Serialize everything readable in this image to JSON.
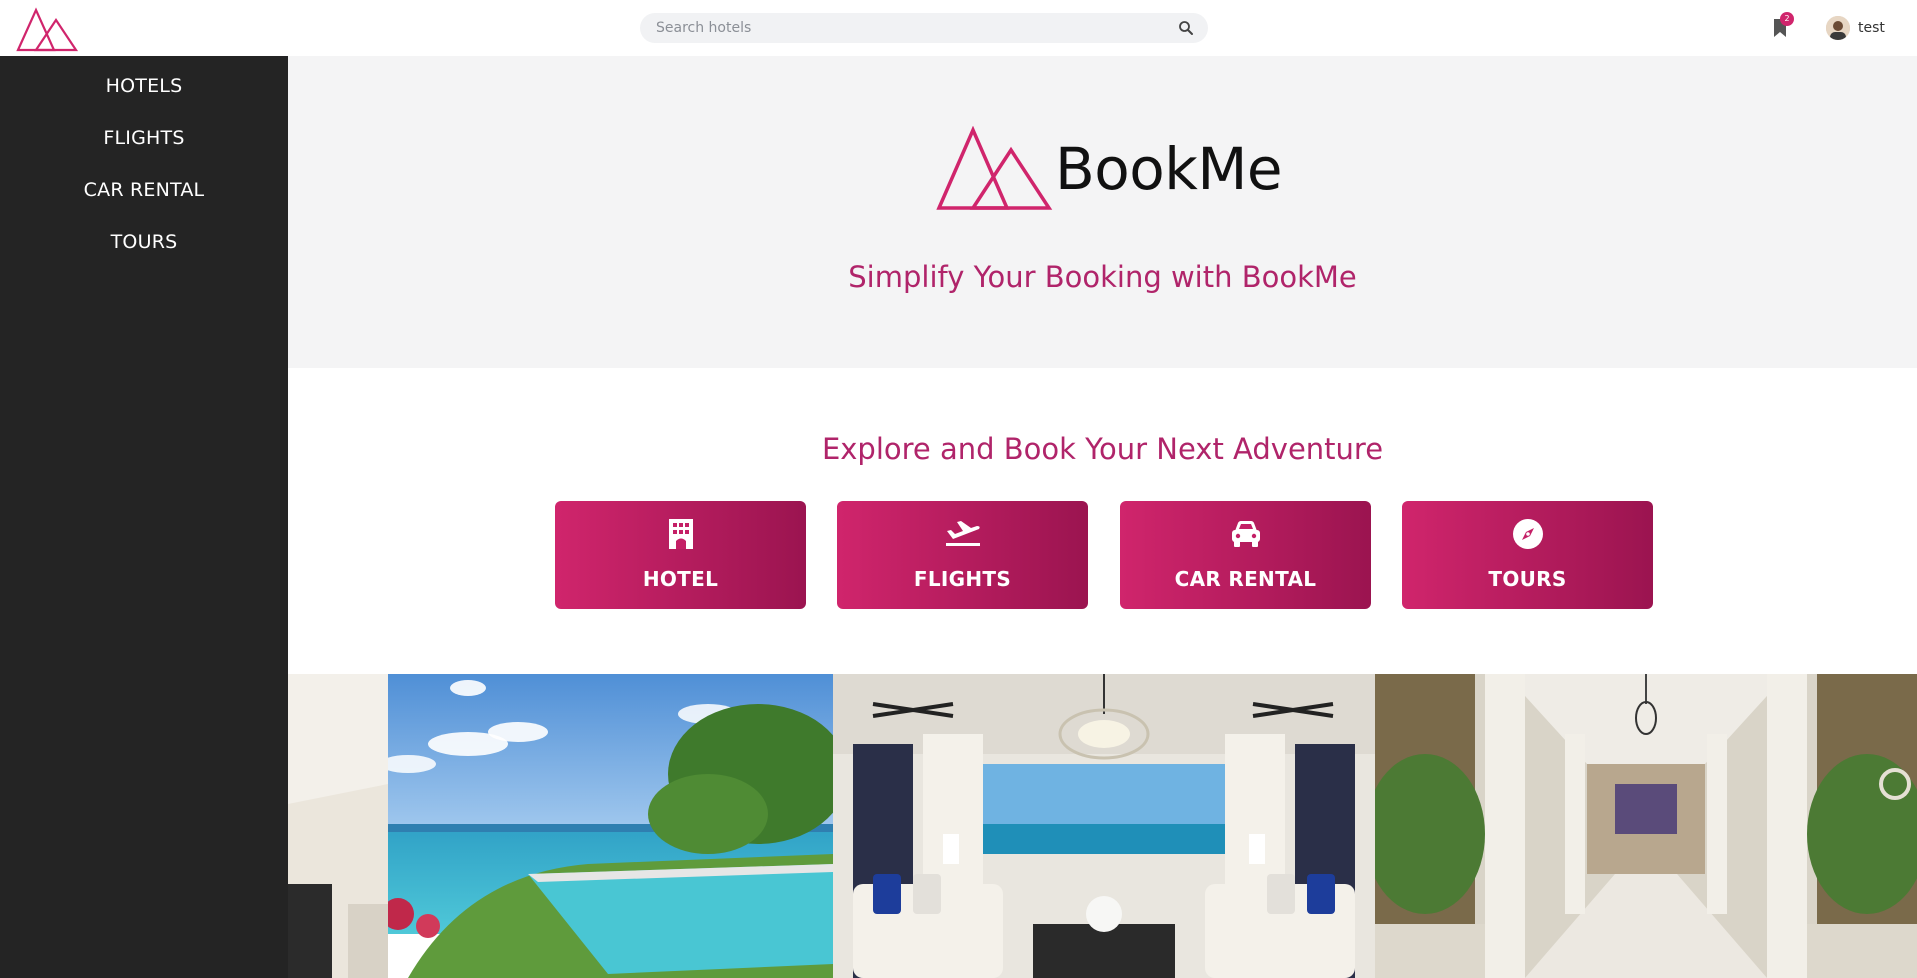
{
  "colors": {
    "accent": "#d0256c",
    "accent_dark": "#9b1450",
    "sidebar_bg": "#242424",
    "hero_bg": "#f4f4f5"
  },
  "header": {
    "search_placeholder": "Search hotels",
    "bookmark_count": "2",
    "user_name": "test"
  },
  "sidebar": {
    "items": [
      {
        "label": "HOTELS"
      },
      {
        "label": "FLIGHTS"
      },
      {
        "label": "CAR RENTAL"
      },
      {
        "label": "TOURS"
      }
    ]
  },
  "hero": {
    "brand_name": "BookMe",
    "tagline": "Simplify Your Booking with BookMe"
  },
  "explore": {
    "title": "Explore and Book Your Next Adventure",
    "categories": [
      {
        "label": "HOTEL",
        "icon": "hotel-icon"
      },
      {
        "label": "FLIGHTS",
        "icon": "plane-icon"
      },
      {
        "label": "CAR RENTAL",
        "icon": "car-icon"
      },
      {
        "label": "TOURS",
        "icon": "compass-icon"
      }
    ]
  },
  "gallery": {
    "images": [
      {
        "name": "ocean-pool-view"
      },
      {
        "name": "living-room-ocean-view"
      },
      {
        "name": "villa-hallway"
      }
    ]
  }
}
